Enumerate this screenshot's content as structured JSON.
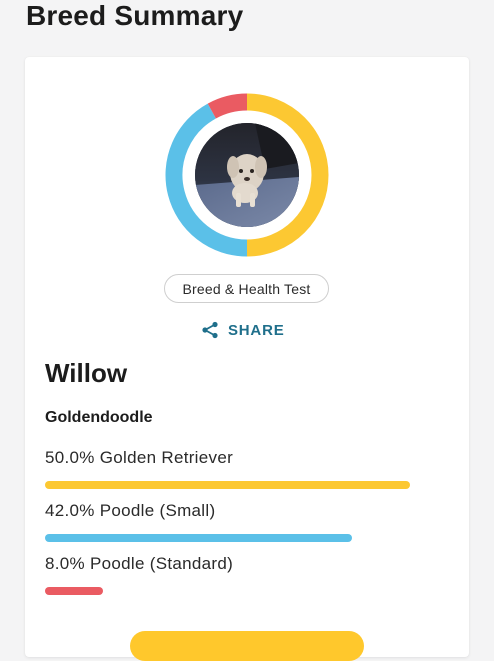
{
  "page": {
    "title": "Breed Summary"
  },
  "card": {
    "test_label": "Breed & Health Test",
    "share_label": "SHARE",
    "dog_name": "Willow",
    "breed_name": "Goldendoodle",
    "breakdown": [
      {
        "label": "50.0% Golden Retriever",
        "percent": 50.0,
        "color": "#fcc832"
      },
      {
        "label": "42.0% Poodle (Small)",
        "percent": 42.0,
        "color": "#5bc0e8"
      },
      {
        "label": "8.0% Poodle (Standard)",
        "percent": 8.0,
        "color": "#ea5b62"
      }
    ]
  },
  "colors": {
    "golden": "#fcc832",
    "poodle_small": "#5bc0e8",
    "poodle_standard": "#ea5b62",
    "share_accent": "#1f6f8b",
    "cta": "#ffc82c"
  },
  "icons": {
    "share": "share-icon"
  }
}
